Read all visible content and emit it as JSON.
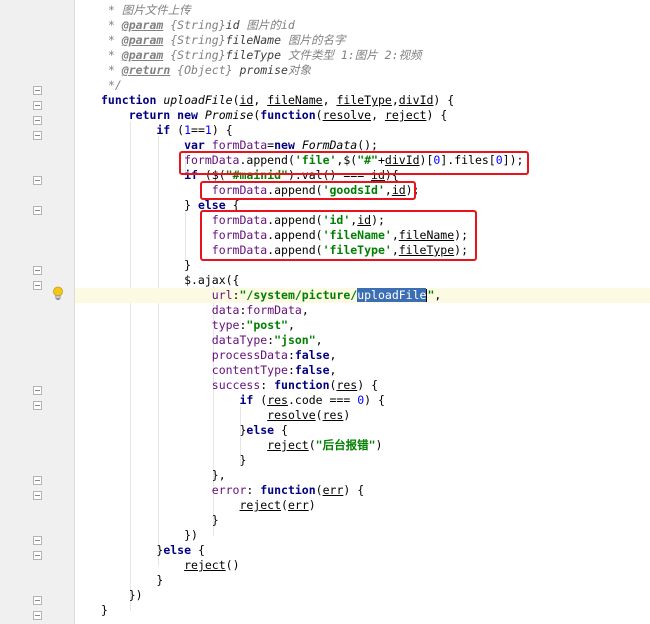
{
  "code_lines": [
    {
      "tokens": [
        [
          "t-comment",
          " * 图片文件上传"
        ]
      ]
    },
    {
      "tokens": [
        [
          "t-comment",
          " * "
        ],
        [
          "t-doctag",
          "@param"
        ],
        [
          "t-doctype",
          " {String}"
        ],
        [
          "t-docname",
          "id"
        ],
        [
          "t-comment",
          " 图片的id"
        ]
      ]
    },
    {
      "tokens": [
        [
          "t-comment",
          " * "
        ],
        [
          "t-doctag",
          "@param"
        ],
        [
          "t-doctype",
          " {String}"
        ],
        [
          "t-docname",
          "fileName"
        ],
        [
          "t-comment",
          " 图片的名字"
        ]
      ]
    },
    {
      "tokens": [
        [
          "t-comment",
          " * "
        ],
        [
          "t-doctag",
          "@param"
        ],
        [
          "t-doctype",
          " {String}"
        ],
        [
          "t-docname",
          "fileType"
        ],
        [
          "t-comment",
          " 文件类型 1:图片 2:视频"
        ]
      ]
    },
    {
      "tokens": [
        [
          "t-comment",
          " * "
        ],
        [
          "t-doctag",
          "@return"
        ],
        [
          "t-doctype",
          " {Object}"
        ],
        [
          "t-docname",
          " promise"
        ],
        [
          "t-comment",
          "对象"
        ]
      ]
    },
    {
      "tokens": [
        [
          "t-comment",
          " */"
        ]
      ]
    },
    {
      "tokens": [
        [
          "t-kw",
          "function "
        ],
        [
          "t-fn",
          "uploadFile"
        ],
        [
          "",
          "("
        ],
        [
          "t-param",
          "id"
        ],
        [
          "",
          ", "
        ],
        [
          "t-param",
          "fileName"
        ],
        [
          "",
          ", "
        ],
        [
          "t-param",
          "fileType"
        ],
        [
          "",
          ","
        ],
        [
          "t-param",
          "divId"
        ],
        [
          "",
          ") {"
        ]
      ]
    },
    {
      "tokens": [
        [
          "t-kw",
          "    return new "
        ],
        [
          "t-fn",
          "Promise"
        ],
        [
          "",
          "("
        ],
        [
          "t-kw",
          "function"
        ],
        [
          "",
          "("
        ],
        [
          "t-param",
          "resolve"
        ],
        [
          "",
          ", "
        ],
        [
          "t-param",
          "reject"
        ],
        [
          "",
          ") {"
        ]
      ]
    },
    {
      "tokens": [
        [
          "t-kw",
          "        if "
        ],
        [
          "",
          "("
        ],
        [
          "t-num",
          "1"
        ],
        [
          "",
          "=="
        ],
        [
          "t-num",
          "1"
        ],
        [
          "",
          ") {"
        ]
      ]
    },
    {
      "tokens": [
        [
          "t-kw",
          "            var "
        ],
        [
          "t-field",
          "formData"
        ],
        [
          "",
          "="
        ],
        [
          "t-kw",
          "new "
        ],
        [
          "t-fn",
          "FormData"
        ],
        [
          "",
          "();"
        ]
      ]
    },
    {
      "tokens": [
        [
          "t-field",
          "            formData"
        ],
        [
          "",
          ".append("
        ],
        [
          "t-str",
          "'file'"
        ],
        [
          "",
          ",$("
        ],
        [
          "t-str",
          "\"#\""
        ],
        [
          "",
          "+"
        ],
        [
          "t-param",
          "divId"
        ],
        [
          "",
          ")["
        ],
        [
          "t-num",
          "0"
        ],
        [
          "",
          "].files["
        ],
        [
          "t-num",
          "0"
        ],
        [
          "",
          "]);"
        ]
      ]
    },
    {
      "tokens": [
        [
          "t-kw",
          "            if "
        ],
        [
          "",
          "($("
        ],
        [
          "t-str",
          "\"#mainid\""
        ],
        [
          "",
          ").val() === "
        ],
        [
          "t-param",
          "id"
        ],
        [
          "",
          "){"
        ]
      ]
    },
    {
      "tokens": [
        [
          "t-field",
          "                formData"
        ],
        [
          "",
          ".append("
        ],
        [
          "t-str",
          "'goodsId'"
        ],
        [
          "",
          ","
        ],
        [
          "t-param",
          "id"
        ],
        [
          "",
          ");"
        ]
      ]
    },
    {
      "tokens": [
        [
          "",
          "            } "
        ],
        [
          "t-kw",
          "else "
        ],
        [
          "",
          "{"
        ]
      ]
    },
    {
      "tokens": [
        [
          "t-field",
          "                formData"
        ],
        [
          "",
          ".append("
        ],
        [
          "t-str",
          "'id'"
        ],
        [
          "",
          ","
        ],
        [
          "t-param",
          "id"
        ],
        [
          "",
          ");"
        ]
      ]
    },
    {
      "tokens": [
        [
          "t-field",
          "                formData"
        ],
        [
          "",
          ".append("
        ],
        [
          "t-str",
          "'fileName'"
        ],
        [
          "",
          ","
        ],
        [
          "t-param",
          "fileName"
        ],
        [
          "",
          ");"
        ]
      ]
    },
    {
      "tokens": [
        [
          "t-field",
          "                formData"
        ],
        [
          "",
          ".append("
        ],
        [
          "t-str",
          "'fileType'"
        ],
        [
          "",
          ","
        ],
        [
          "t-param",
          "fileType"
        ],
        [
          "",
          ");"
        ]
      ]
    },
    {
      "tokens": [
        [
          "",
          "            }"
        ]
      ]
    },
    {
      "tokens": [
        [
          "",
          "            $.ajax({"
        ]
      ]
    },
    {
      "tokens": [
        [
          "t-field",
          "                url"
        ],
        [
          "",
          ":"
        ],
        [
          "t-str",
          "\"/system/picture/"
        ],
        [
          "t-sel",
          "uploadFile"
        ],
        [
          "t-str",
          "\""
        ],
        [
          "",
          ","
        ]
      ]
    },
    {
      "tokens": [
        [
          "t-field",
          "                data"
        ],
        [
          "",
          ":"
        ],
        [
          "t-field",
          "formData"
        ],
        [
          "",
          ","
        ]
      ]
    },
    {
      "tokens": [
        [
          "t-field",
          "                type"
        ],
        [
          "",
          ":"
        ],
        [
          "t-str",
          "\"post\""
        ],
        [
          "",
          ","
        ]
      ]
    },
    {
      "tokens": [
        [
          "t-field",
          "                dataType"
        ],
        [
          "",
          ":"
        ],
        [
          "t-str",
          "\"json\""
        ],
        [
          "",
          ","
        ]
      ]
    },
    {
      "tokens": [
        [
          "t-field",
          "                processData"
        ],
        [
          "",
          ":"
        ],
        [
          "t-kw",
          "false"
        ],
        [
          "",
          ","
        ]
      ]
    },
    {
      "tokens": [
        [
          "t-field",
          "                contentType"
        ],
        [
          "",
          ":"
        ],
        [
          "t-kw",
          "false"
        ],
        [
          "",
          ","
        ]
      ]
    },
    {
      "tokens": [
        [
          "t-field",
          "                success"
        ],
        [
          "",
          ": "
        ],
        [
          "t-kw",
          "function"
        ],
        [
          "",
          "("
        ],
        [
          "t-param",
          "res"
        ],
        [
          "",
          ") {"
        ]
      ]
    },
    {
      "tokens": [
        [
          "t-kw",
          "                    if "
        ],
        [
          "",
          "("
        ],
        [
          "t-param",
          "res"
        ],
        [
          "",
          ".code === "
        ],
        [
          "t-num",
          "0"
        ],
        [
          "",
          ") {"
        ]
      ]
    },
    {
      "tokens": [
        [
          "",
          "                        "
        ],
        [
          "t-param",
          "resolve"
        ],
        [
          "",
          "("
        ],
        [
          "t-param",
          "res"
        ],
        [
          "",
          ")"
        ]
      ]
    },
    {
      "tokens": [
        [
          "",
          "                    }"
        ],
        [
          "t-kw",
          "else "
        ],
        [
          "",
          "{"
        ]
      ]
    },
    {
      "tokens": [
        [
          "",
          "                        "
        ],
        [
          "t-param",
          "reject"
        ],
        [
          "",
          "("
        ],
        [
          "t-str",
          "\"后台报错\""
        ],
        [
          "",
          ")"
        ]
      ]
    },
    {
      "tokens": [
        [
          "",
          "                    }"
        ]
      ]
    },
    {
      "tokens": [
        [
          "",
          "                },"
        ]
      ]
    },
    {
      "tokens": [
        [
          "t-field",
          "                error"
        ],
        [
          "",
          ": "
        ],
        [
          "t-kw",
          "function"
        ],
        [
          "",
          "("
        ],
        [
          "t-param",
          "err"
        ],
        [
          "",
          ") {"
        ]
      ]
    },
    {
      "tokens": [
        [
          "",
          "                    "
        ],
        [
          "t-param",
          "reject"
        ],
        [
          "",
          "("
        ],
        [
          "t-param",
          "err"
        ],
        [
          "",
          ")"
        ]
      ]
    },
    {
      "tokens": [
        [
          "",
          "                }"
        ]
      ]
    },
    {
      "tokens": [
        [
          "",
          "            })"
        ]
      ]
    },
    {
      "tokens": [
        [
          "",
          "        }"
        ],
        [
          "t-kw",
          "else "
        ],
        [
          "",
          "{"
        ]
      ]
    },
    {
      "tokens": [
        [
          "",
          "            "
        ],
        [
          "t-param",
          "reject"
        ],
        [
          "",
          "()"
        ]
      ]
    },
    {
      "tokens": [
        [
          "",
          "        }"
        ]
      ]
    },
    {
      "tokens": [
        [
          "",
          "    })"
        ]
      ]
    },
    {
      "tokens": [
        [
          "",
          "}"
        ]
      ]
    }
  ],
  "current_line_index": 19,
  "colors": {
    "highlight_box": "#e8131b",
    "selection": "#3b6eb3",
    "current_line": "#fcfae2"
  },
  "icons": {
    "intention": "lightbulb-icon",
    "fold": "fold-marker-icon"
  }
}
